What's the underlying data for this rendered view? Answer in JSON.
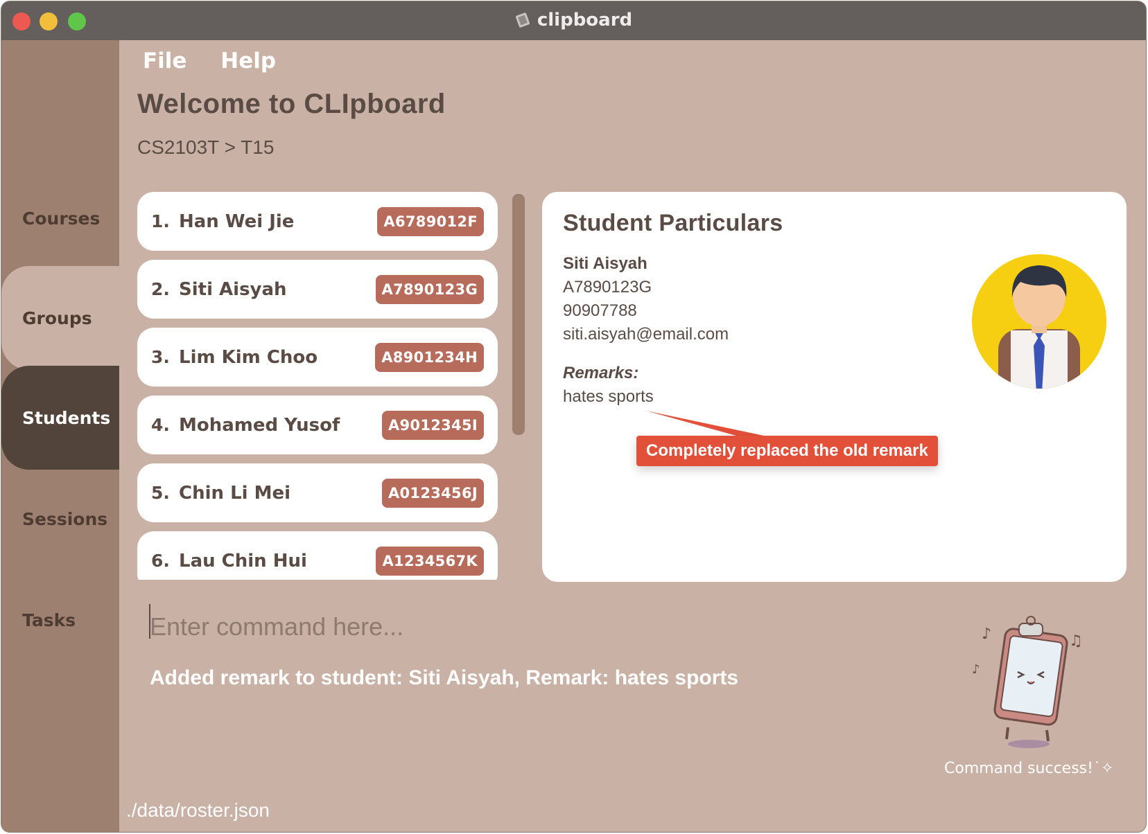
{
  "window": {
    "title": "clipboard"
  },
  "menu": {
    "file": "File",
    "help": "Help"
  },
  "header": {
    "welcome": "Welcome to CLIpboard",
    "breadcrumb": "CS2103T > T15"
  },
  "sidebar": {
    "items": [
      {
        "label": "Courses",
        "state": "normal"
      },
      {
        "label": "Groups",
        "state": "highlighted"
      },
      {
        "label": "Students",
        "state": "selected"
      },
      {
        "label": "Sessions",
        "state": "normal"
      },
      {
        "label": "Tasks",
        "state": "normal"
      }
    ]
  },
  "students": [
    {
      "index": "1.",
      "name": "Han Wei Jie",
      "id": "A6789012F"
    },
    {
      "index": "2.",
      "name": "Siti Aisyah",
      "id": "A7890123G"
    },
    {
      "index": "3.",
      "name": "Lim Kim Choo",
      "id": "A8901234H"
    },
    {
      "index": "4.",
      "name": "Mohamed Yusof",
      "id": "A9012345I"
    },
    {
      "index": "5.",
      "name": "Chin Li Mei",
      "id": "A0123456J"
    },
    {
      "index": "6.",
      "name": "Lau Chin Hui",
      "id": "A1234567K"
    }
  ],
  "particulars": {
    "heading": "Student Particulars",
    "name": "Siti Aisyah",
    "student_id": "A7890123G",
    "phone": "90907788",
    "email": "siti.aisyah@email.com",
    "remarks_label": "Remarks:",
    "remarks": "hates sports",
    "annotation": "Completely replaced the old remark"
  },
  "command": {
    "placeholder": "Enter command here...",
    "value": ""
  },
  "result": {
    "message": "Added remark to student: Siti Aisyah, Remark: hates sports"
  },
  "status": {
    "caption": "Command success!˙✧"
  },
  "footer": {
    "path": "./data/roster.json"
  },
  "colors": {
    "background": "#c9b2a5",
    "sidebar": "#9e8070",
    "sidebar_selected": "#53443b",
    "badge": "#b66b5b",
    "annotation": "#e2503a",
    "titlebar": "#645f5c"
  },
  "icons": {
    "title": "clipboard-icon",
    "avatar": "student-avatar",
    "mascot": "clipboard-mascot"
  }
}
